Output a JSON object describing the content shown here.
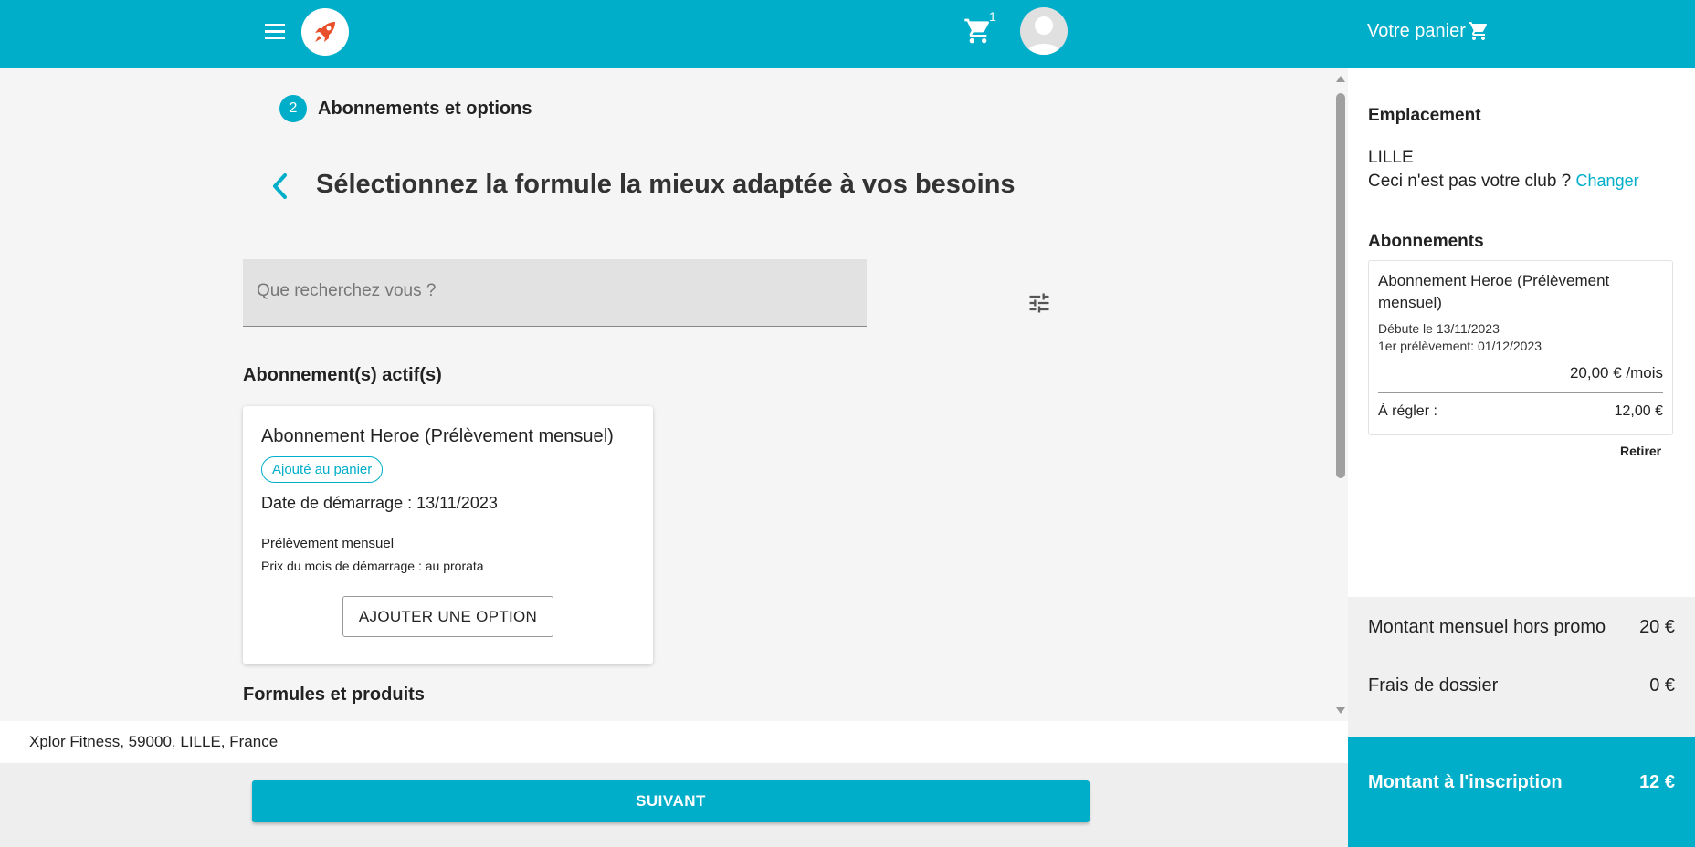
{
  "header": {
    "cart_count": "1",
    "cart_title": "Votre panier",
    "accent_color": "#00aec9",
    "logo_color": "#e8502b"
  },
  "step": {
    "number": "2",
    "label": "Abonnements et options"
  },
  "page": {
    "heading": "Sélectionnez la formule la mieux adaptée à vos besoins"
  },
  "search": {
    "placeholder": "Que recherchez vous ?"
  },
  "active_section": {
    "title": "Abonnement(s) actif(s)",
    "card": {
      "title": "Abonnement Heroe (Prélèvement mensuel)",
      "badge": "Ajouté au panier",
      "start_date": "Date de démarrage : 13/11/2023",
      "billing": "Prélèvement mensuel",
      "first_month": "Prix du mois de démarrage : au prorata",
      "option_button": "AJOUTER UNE OPTION"
    }
  },
  "products_section": {
    "title": "Formules et produits"
  },
  "footer": {
    "address": "Xplor Fitness, 59000, LILLE, France",
    "next_button": "SUIVANT"
  },
  "sidebar": {
    "location_label": "Emplacement",
    "club": "LILLE",
    "club_question": "Ceci n'est pas votre club ?",
    "change_link": "Changer",
    "subscriptions_label": "Abonnements",
    "subscription": {
      "name": "Abonnement Heroe (Prélèvement mensuel)",
      "start": "Débute le 13/11/2023",
      "first_debit": "1er prélèvement: 01/12/2023",
      "price": "20,00 € /mois",
      "due_label": "À régler :",
      "due_value": "12,00 €"
    },
    "remove": "Retirer",
    "monthly_label": "Montant mensuel hors promo",
    "monthly_value": "20 €",
    "fees_label": "Frais de dossier",
    "fees_value": "0 €",
    "total_label": "Montant à l'inscription",
    "total_value": "12 €"
  }
}
